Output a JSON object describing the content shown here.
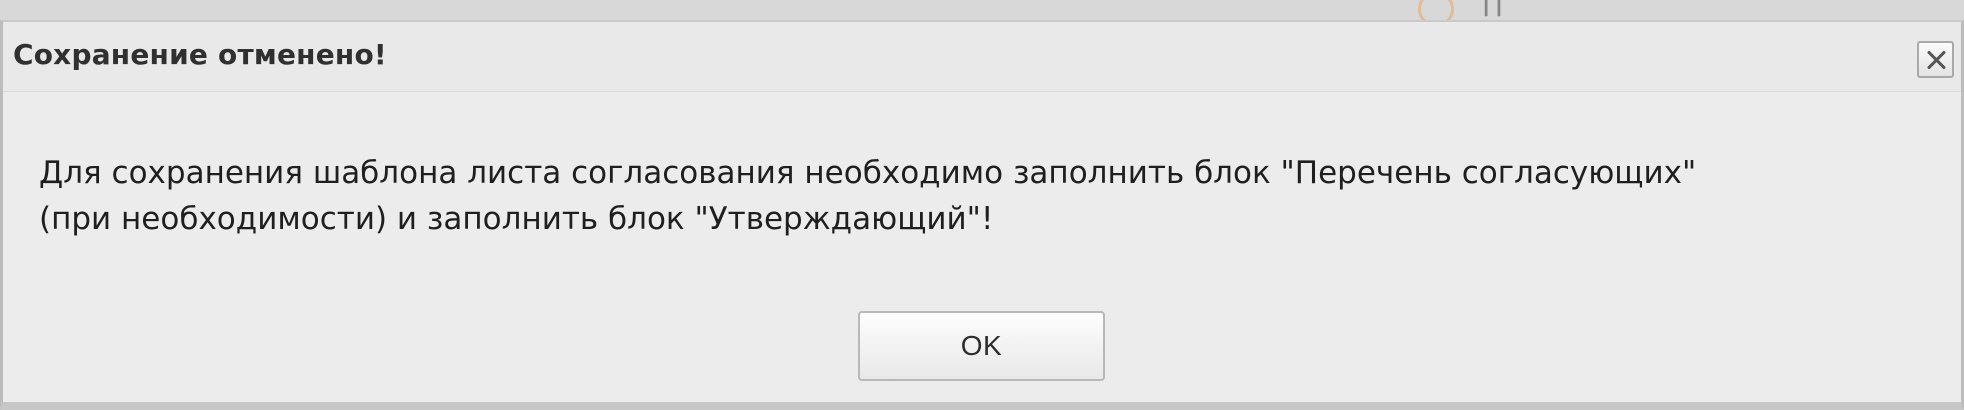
{
  "dialog": {
    "title": "Сохранение отменено!",
    "message_line_1": "Для сохранения шаблона листа согласования необходимо заполнить блок \"Перечень согласующих\"",
    "message_line_2": "(при необходимости) и заполнить блок \"Утверждающий\"!",
    "ok_label": "OK"
  },
  "icons": {
    "close": "close-icon"
  }
}
